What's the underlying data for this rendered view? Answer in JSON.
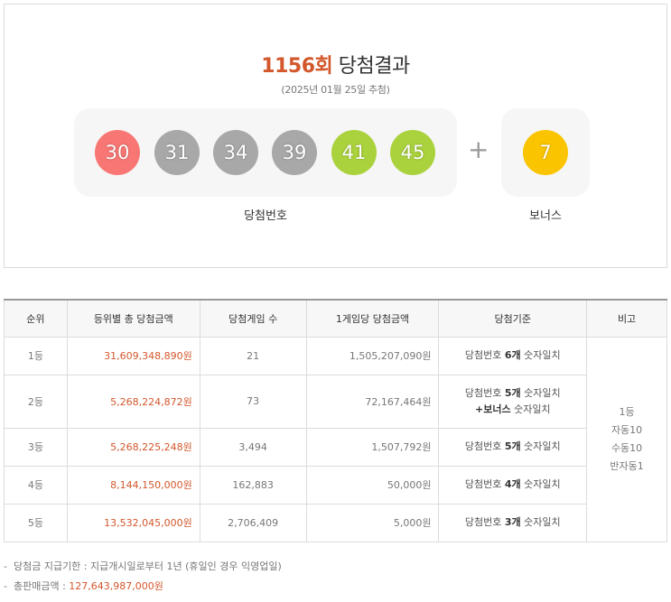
{
  "header": {
    "round": "1156회",
    "title": "당첨결과",
    "draw_date": "(2025년 01월 25일 추첨)"
  },
  "balls": [
    {
      "number": "30",
      "color": "#f87774"
    },
    {
      "number": "31",
      "color": "#a8a8a8"
    },
    {
      "number": "34",
      "color": "#a8a8a8"
    },
    {
      "number": "39",
      "color": "#a8a8a8"
    },
    {
      "number": "41",
      "color": "#aad23d"
    },
    {
      "number": "45",
      "color": "#aad23d"
    }
  ],
  "plus": "+",
  "bonus": {
    "number": "7",
    "color": "#fbc400"
  },
  "captions": {
    "winning": "당첨번호",
    "bonus": "보너스"
  },
  "table": {
    "headers": [
      "순위",
      "등위별 총 당첨금액",
      "당첨게임 수",
      "1게임당 당첨금액",
      "당첨기준",
      "비고"
    ],
    "rows": [
      {
        "rank": "1등",
        "total": "31,609,348,890원",
        "winners": "21",
        "per_game": "1,505,207,090원",
        "criteria_prefix": "당첨번호 ",
        "criteria_count": "6개",
        "criteria_suffix": " 숫자일치",
        "criteria_line2_bold": "",
        "criteria_line2": ""
      },
      {
        "rank": "2등",
        "total": "5,268,224,872원",
        "winners": "73",
        "per_game": "72,167,464원",
        "criteria_prefix": "당첨번호 ",
        "criteria_count": "5개",
        "criteria_suffix": " 숫자일치",
        "criteria_line2_bold": "+보너스",
        "criteria_line2": " 숫자일치"
      },
      {
        "rank": "3등",
        "total": "5,268,225,248원",
        "winners": "3,494",
        "per_game": "1,507,792원",
        "criteria_prefix": "당첨번호 ",
        "criteria_count": "5개",
        "criteria_suffix": " 숫자일치",
        "criteria_line2_bold": "",
        "criteria_line2": ""
      },
      {
        "rank": "4등",
        "total": "8,144,150,000원",
        "winners": "162,883",
        "per_game": "50,000원",
        "criteria_prefix": "당첨번호 ",
        "criteria_count": "4개",
        "criteria_suffix": " 숫자일치",
        "criteria_line2_bold": "",
        "criteria_line2": ""
      },
      {
        "rank": "5등",
        "total": "13,532,045,000원",
        "winners": "2,706,409",
        "per_game": "5,000원",
        "criteria_prefix": "당첨번호 ",
        "criteria_count": "3개",
        "criteria_suffix": " 숫자일치",
        "criteria_line2_bold": "",
        "criteria_line2": ""
      }
    ],
    "note": [
      "1등",
      "자동10",
      "수동10",
      "반자동1"
    ]
  },
  "notes": {
    "payment_deadline": "당첨금 지급기한 : 지급개시일로부터 1년 (휴일인 경우 익영업일)",
    "total_sales_label": "총판매금액 : ",
    "total_sales_value": "127,643,987,000원"
  }
}
